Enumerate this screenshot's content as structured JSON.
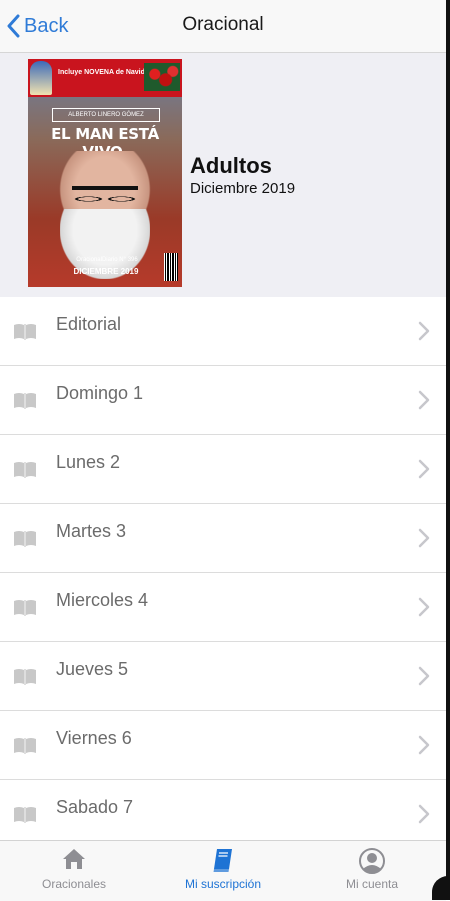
{
  "navbar": {
    "back_label": "Back",
    "title": "Oracional"
  },
  "issue": {
    "name": "Adultos",
    "date": "Diciembre 2019",
    "cover": {
      "band_text": "Incluye NOVENA de Navidad",
      "author": "ALBERTO LINERO GÓMEZ",
      "headline": "EL MAN ESTÁ VIVO.",
      "issue_number": "OracionalDiario N° 396",
      "issue_date": "DICIEMBRE 2019"
    }
  },
  "list": {
    "items": [
      {
        "label": "Editorial"
      },
      {
        "label": "Domingo 1"
      },
      {
        "label": "Lunes 2"
      },
      {
        "label": "Martes 3"
      },
      {
        "label": "Miercoles 4"
      },
      {
        "label": "Jueves 5"
      },
      {
        "label": "Viernes 6"
      },
      {
        "label": "Sabado 7"
      }
    ]
  },
  "tabbar": {
    "tabs": [
      {
        "label": "Oracionales",
        "icon": "home-icon"
      },
      {
        "label": "Mi suscripción",
        "icon": "book-icon",
        "active": true
      },
      {
        "label": "Mi cuenta",
        "icon": "user-icon"
      }
    ]
  },
  "colors": {
    "accent": "#1e73d4",
    "back": "#2f7bd7",
    "row_text": "#6b6b6b",
    "header_bg": "#efeff4"
  }
}
